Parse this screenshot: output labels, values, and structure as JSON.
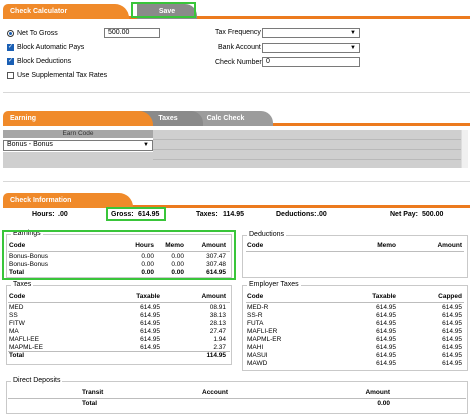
{
  "calculator": {
    "tab_label": "Check Calculator",
    "save_label": "Save",
    "net_to_gross_label": "Net To Gross",
    "net_to_gross_value": "500.00",
    "block_auto_pays_label": "Block Automatic Pays",
    "block_deductions_label": "Block Deductions",
    "use_supp_label": "Use Supplemental Tax Rates",
    "tax_frequency_label": "Tax Frequency",
    "bank_account_label": "Bank Account",
    "check_number_label": "Check Number",
    "check_number_value": "0"
  },
  "earning_tabs": {
    "earning": "Earning",
    "taxes": "Taxes",
    "calc_check": "Calc Check",
    "col_earn_code": "Earn Code",
    "earn_code_value": "Bonus - Bonus"
  },
  "check_info": {
    "tab_label": "Check Information",
    "hours_label": "Hours:",
    "hours_value": ".00",
    "gross_label": "Gross:",
    "gross_value": "614.95",
    "taxes_label": "Taxes:",
    "taxes_value": "114.95",
    "deductions_label": "Deductions:",
    "deductions_value": ".00",
    "netpay_label": "Net Pay:",
    "netpay_value": "500.00"
  },
  "earnings": {
    "title": "Earnings",
    "headers": [
      "Code",
      "Hours",
      "Memo",
      "Amount"
    ],
    "rows": [
      [
        "Bonus-Bonus",
        "0.00",
        "0.00",
        "307.47"
      ],
      [
        "Bonus-Bonus",
        "0.00",
        "0.00",
        "307.48"
      ],
      [
        "Total",
        "0.00",
        "0.00",
        "614.95"
      ]
    ]
  },
  "deductions": {
    "title": "Deductions",
    "headers": [
      "Code",
      "Memo",
      "Amount"
    ]
  },
  "taxes": {
    "title": "Taxes",
    "headers": [
      "Code",
      "Taxable",
      "Amount"
    ],
    "rows": [
      [
        "MED",
        "614.95",
        "08.91"
      ],
      [
        "SS",
        "614.95",
        "38.13"
      ],
      [
        "FITW",
        "614.95",
        "28.13"
      ],
      [
        "MA",
        "614.95",
        "27.47"
      ],
      [
        "MAFLI-EE",
        "614.95",
        "1.94"
      ],
      [
        "MAPML-EE",
        "614.95",
        "2.37"
      ],
      [
        "Total",
        "",
        "114.95"
      ]
    ]
  },
  "employer_taxes": {
    "title": "Employer Taxes",
    "headers": [
      "Code",
      "Taxable",
      "Capped"
    ],
    "rows": [
      [
        "MED-R",
        "614.95",
        "614.95"
      ],
      [
        "SS-R",
        "614.95",
        "614.95"
      ],
      [
        "FUTA",
        "614.95",
        "614.95"
      ],
      [
        "MAFLI-ER",
        "614.95",
        "614.95"
      ],
      [
        "MAPML-ER",
        "614.95",
        "614.95"
      ],
      [
        "MAHI",
        "614.95",
        "614.95"
      ],
      [
        "MASUI",
        "614.95",
        "614.95"
      ],
      [
        "MAWD",
        "614.95",
        "614.95"
      ]
    ]
  },
  "direct_deposits": {
    "title": "Direct Deposits",
    "headers": [
      "Transit",
      "Account",
      "Amount"
    ],
    "total_label": "Total",
    "total_value": "0.00"
  }
}
